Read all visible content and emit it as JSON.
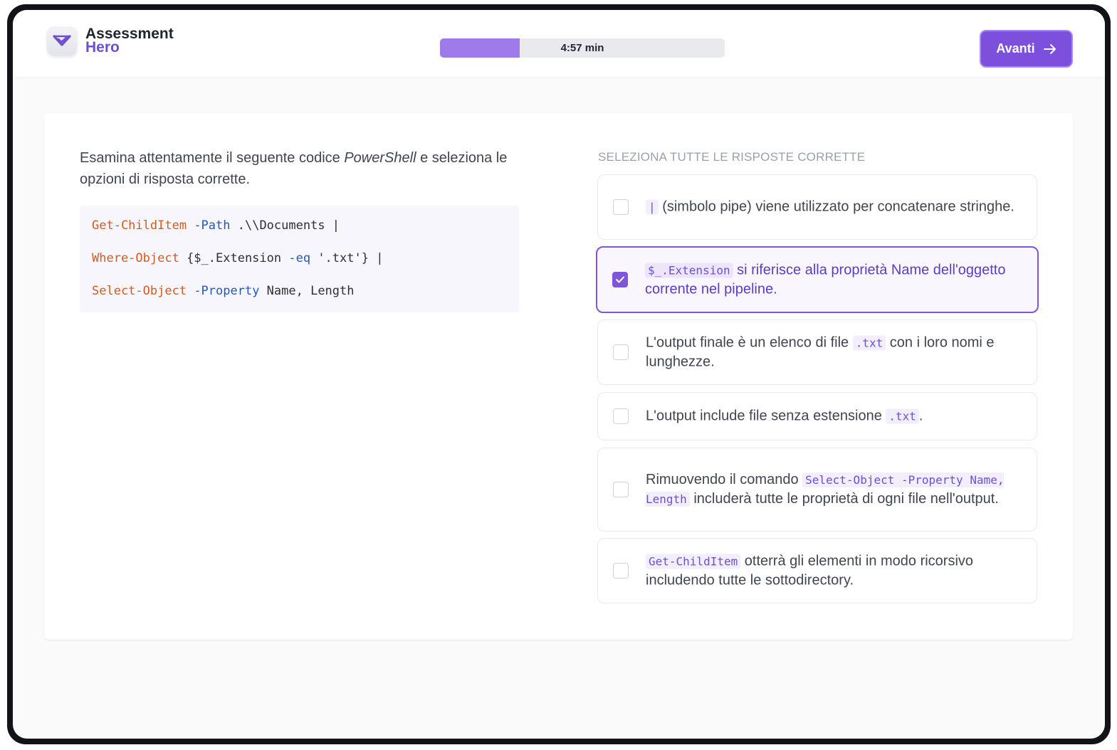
{
  "app": {
    "logo_line1": "Assessment",
    "logo_line2": "Hero"
  },
  "header": {
    "timer_label": "4:57 min",
    "progress_fraction": 0.28,
    "next_label": "Avanti"
  },
  "question": {
    "prefix": "Esamina attentamente il seguente codice ",
    "emphasis": "PowerShell",
    "suffix": " e seleziona le opzioni di risposta corrette.",
    "code": {
      "line1": {
        "cmd": "Get-ChildItem",
        "param": "-Path",
        "rest": " .\\\\Documents |"
      },
      "line2": {
        "cmd": "Where-Object",
        "text_a": " {$_.Extension ",
        "param": "-eq",
        "text_b": " '.txt'} |"
      },
      "line3": {
        "cmd": "Select-Object",
        "param": "-Property",
        "rest": " Name, Length"
      }
    }
  },
  "answers": {
    "instruction": "SELEZIONA TUTTE LE RISPOSTE CORRETTE",
    "options": [
      {
        "code_a": "|",
        "text_a": " (simbolo pipe) viene utilizzato per concatenare stringhe.",
        "selected": false
      },
      {
        "code_a": "$_.Extension",
        "text_a": " si riferisce alla proprietà Name dell'oggetto corrente nel pipeline.",
        "selected": true
      },
      {
        "text_a": "L'output finale è un elenco di file ",
        "code_a": ".txt",
        "text_b": " con i loro nomi e lunghezze.",
        "selected": false
      },
      {
        "text_a": "L'output include file senza estensione ",
        "code_a": ".txt",
        "text_b": ".",
        "selected": false
      },
      {
        "text_a": "Rimuovendo il comando ",
        "code_a": "Select-Object -Property Name, Length",
        "text_b": " includerà tutte le proprietà di ogni file nell'output.",
        "selected": false
      },
      {
        "code_a": "Get-ChildItem",
        "text_a": " otterrà gli elementi in modo ricorsivo includendo tutte le sottodirectory.",
        "selected": false
      }
    ]
  },
  "colors": {
    "accent": "#7c4fdc",
    "progress_fill": "#9f7aea",
    "code_command": "#d35b1f",
    "code_parameter": "#2357b8"
  },
  "icons": {
    "logo": "check-badge-icon",
    "next": "arrow-right-icon",
    "checkbox_checked": "check-icon"
  }
}
